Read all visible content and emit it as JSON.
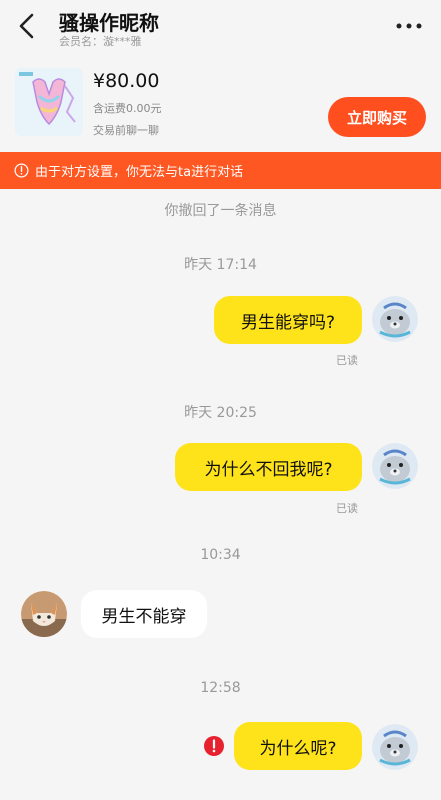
{
  "header": {
    "title": "骚操作昵称",
    "subtitle": "会员名：漩***雅",
    "back_icon": "chevron-left-icon",
    "more_icon": "more-dots-icon"
  },
  "product": {
    "price": "¥80.00",
    "shipping": "含运费0.00元",
    "note": "交易前聊一聊",
    "buy_label": "立即购买",
    "accent": "#ff4f1f"
  },
  "warning": {
    "text": "由于对方设置，你无法与ta进行对话",
    "icon": "info-circle-icon",
    "color": "#ff5722"
  },
  "messages": {
    "recalled": "你撤回了一条消息",
    "t1": "昨天 17:14",
    "m1": "男生能穿吗?",
    "r1": "已读",
    "t2": "昨天 20:25",
    "m2": "为什么不回我呢?",
    "r2": "已读",
    "t3": "10:34",
    "m3": "男生不能穿",
    "t4": "12:58",
    "m4": "为什么呢?"
  }
}
